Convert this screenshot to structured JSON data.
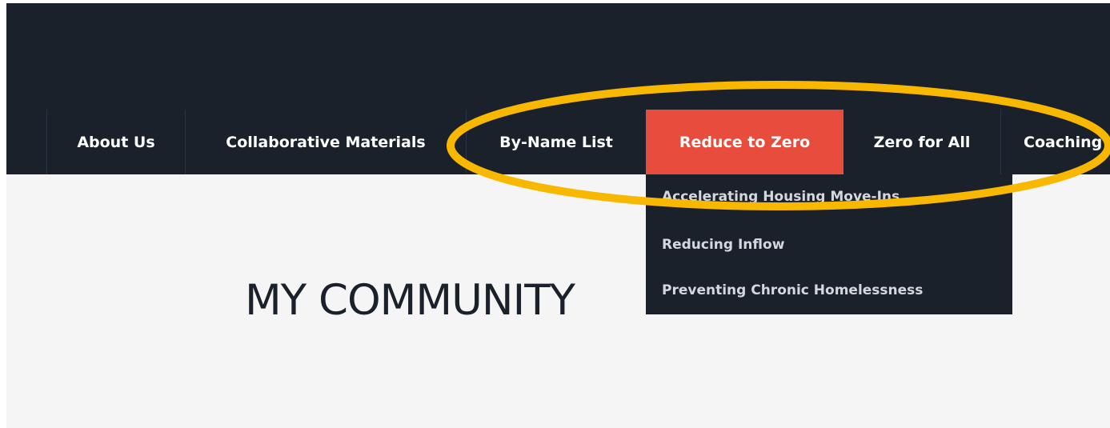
{
  "nav": {
    "items": [
      {
        "label": "About Us"
      },
      {
        "label": "Collaborative Materials"
      },
      {
        "label": "By-Name List"
      },
      {
        "label": "Reduce to Zero",
        "active": true
      },
      {
        "label": "Zero for All"
      },
      {
        "label": "Coaching"
      }
    ]
  },
  "dropdown": {
    "items": [
      {
        "label": "Accelerating Housing Move-Ins"
      },
      {
        "label": "Reducing Inflow"
      },
      {
        "label": "Preventing Chronic Homelessness"
      }
    ]
  },
  "page": {
    "heading": "MY COMMUNITY"
  },
  "colors": {
    "header_bg": "#1b212b",
    "active_tab": "#e74c3c",
    "content_bg": "#f5f5f5",
    "highlight_ring": "#f9b800"
  }
}
